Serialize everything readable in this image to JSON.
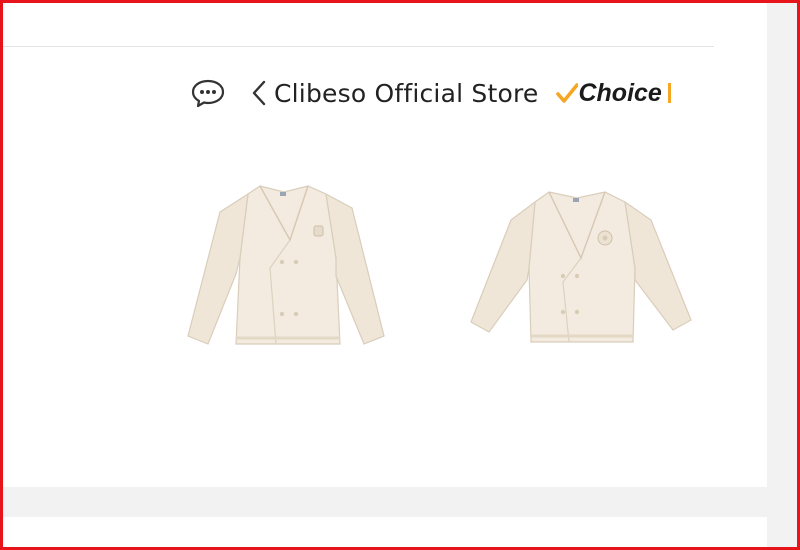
{
  "store": {
    "name": "Clibeso Official Store",
    "badge": "Choice",
    "icons": [
      "chat-icon",
      "chevron-left-icon",
      "check-icon"
    ]
  },
  "products": [
    {
      "name": "cream-cardigan-1"
    },
    {
      "name": "cream-cardigan-2"
    }
  ],
  "colors": {
    "frame": "#e8141b",
    "badge_accent": "#f5a623",
    "garment": "#f3ebdf",
    "panel_gray": "#f2f2f2"
  }
}
